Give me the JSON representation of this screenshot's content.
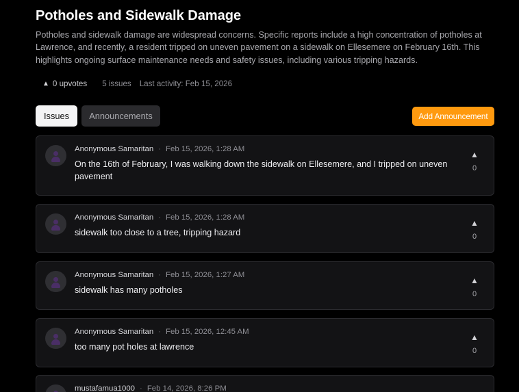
{
  "header": {
    "title": "Potholes and Sidewalk Damage",
    "description": "Potholes and sidewalk damage are widespread concerns. Specific reports include a high concentration of potholes at Lawrence, and recently, a resident tripped on uneven pavement on a sidewalk on Ellesemere on February 16th. This highlights ongoing surface maintenance needs and safety issues, including various tripping hazards."
  },
  "meta": {
    "upvote_icon": "▲",
    "upvotes": "0 upvotes",
    "issues": "5 issues",
    "last_activity": "Last activity: Feb 15, 2026"
  },
  "tabs": [
    {
      "label": "Issues",
      "active": true
    },
    {
      "label": "Announcements",
      "active": false
    }
  ],
  "add_button": "Add Announcement",
  "colors": {
    "accent": "#ff9a0f",
    "background": "#000000",
    "card": "#131315"
  },
  "posts": [
    {
      "author": "Anonymous Samaritan",
      "separator": "·",
      "time": "Feb 15, 2026, 1:28 AM",
      "text": "On the 16th of February, I was walking down the sidewalk on Ellesemere, and I tripped on uneven pavement",
      "vote_icon": "▲",
      "votes": "0"
    },
    {
      "author": "Anonymous Samaritan",
      "separator": "·",
      "time": "Feb 15, 2026, 1:28 AM",
      "text": "sidewalk too close to a tree, tripping hazard",
      "vote_icon": "▲",
      "votes": "0"
    },
    {
      "author": "Anonymous Samaritan",
      "separator": "·",
      "time": "Feb 15, 2026, 1:27 AM",
      "text": "sidewalk has many potholes",
      "vote_icon": "▲",
      "votes": "0"
    },
    {
      "author": "Anonymous Samaritan",
      "separator": "·",
      "time": "Feb 15, 2026, 12:45 AM",
      "text": "too many pot holes at lawrence",
      "vote_icon": "▲",
      "votes": "0"
    },
    {
      "author": "mustafamua1000",
      "separator": "·",
      "time": "Feb 14, 2026, 8:26 PM",
      "text": "",
      "vote_icon": "▲",
      "votes": ""
    }
  ]
}
